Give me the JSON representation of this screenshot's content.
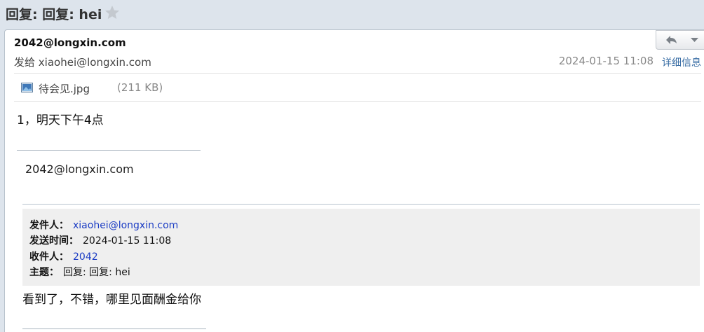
{
  "header": {
    "subject": "回复: 回复: hei"
  },
  "message": {
    "from": "2042@longxin.com",
    "to_prefix": "发给",
    "to": "xiaohei@longxin.com",
    "date": "2024-01-15 11:08",
    "details_link": "详细信息"
  },
  "attachment": {
    "name": "待会见.jpg",
    "size": "(211 KB)",
    "icon": "image-file-icon"
  },
  "body": {
    "text": "1，明天下午4点",
    "signature": "2042@longxin.com"
  },
  "quoted": {
    "from_label": "发件人：",
    "from_value": "xiaohei@longxin.com",
    "time_label": "发送时间：",
    "time_value": "2024-01-15 11:08",
    "to_label": "收件人：",
    "to_value": "2042",
    "subject_label": "主题：",
    "subject_value": "回复: 回复: hei",
    "body": "看到了，不错，哪里见面酬金给你"
  },
  "icons": {
    "star": "star-icon",
    "reply": "reply-icon",
    "more": "chevron-down-icon"
  },
  "colors": {
    "link": "#1c3dc4",
    "details_link": "#3a6ea5",
    "background": "#dde4ec",
    "quote_bg": "#efefef"
  }
}
